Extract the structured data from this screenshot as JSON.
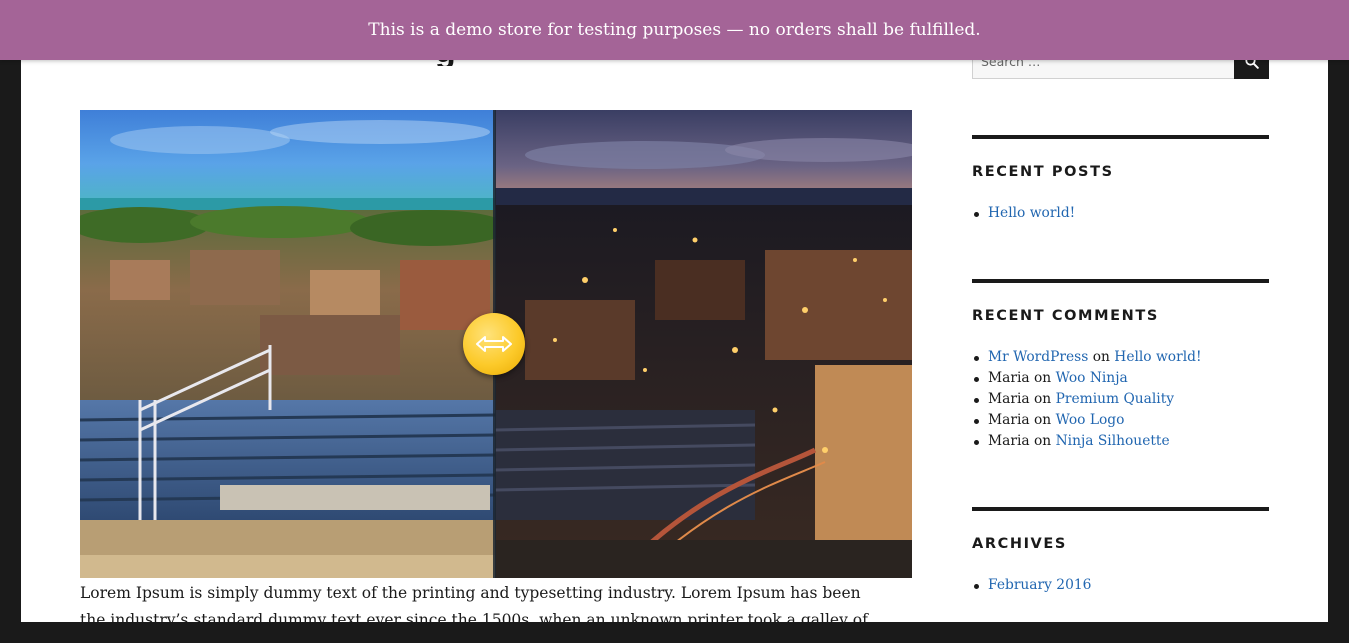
{
  "demo_notice": "This is a demo store for testing purposes — no orders shall be fulfilled.",
  "post": {
    "title_fragment": "g",
    "body_lines": [
      "Lorem Ipsum is simply dummy text of the printing and typesetting industry. Lorem Ipsum has been",
      "the industry’s standard dummy text ever since the 1500s, when an unknown printer took a galley of"
    ]
  },
  "comparison": {
    "position_percent": 50,
    "handle_icon": "left-right-arrow-icon"
  },
  "sidebar": {
    "search": {
      "placeholder": "Search …",
      "icon": "search-icon"
    },
    "recent_posts": {
      "heading": "RECENT POSTS",
      "items": [
        "Hello world!"
      ]
    },
    "recent_comments": {
      "heading": "RECENT COMMENTS",
      "items": [
        {
          "author": "Mr WordPress",
          "author_is_link": true,
          "on": "on",
          "post": "Hello world!"
        },
        {
          "author": "Maria",
          "author_is_link": false,
          "on": "on",
          "post": "Woo Ninja"
        },
        {
          "author": "Maria",
          "author_is_link": false,
          "on": "on",
          "post": "Premium Quality"
        },
        {
          "author": "Maria",
          "author_is_link": false,
          "on": "on",
          "post": "Woo Logo"
        },
        {
          "author": "Maria",
          "author_is_link": false,
          "on": "on",
          "post": "Ninja Silhouette"
        }
      ]
    },
    "archives": {
      "heading": "ARCHIVES",
      "items": [
        "February 2016"
      ]
    }
  },
  "colors": {
    "demo_bar": "#a46497",
    "link": "#2166b0",
    "text": "#1a1a1a",
    "frame": "#1a1a1a",
    "handle": "#fcca2a"
  }
}
